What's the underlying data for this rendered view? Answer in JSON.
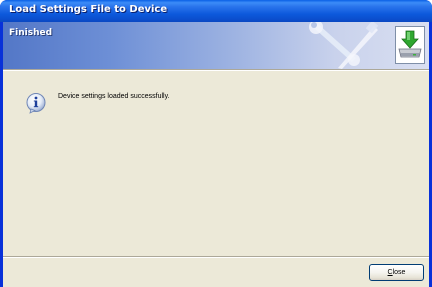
{
  "window": {
    "title": "Load Settings File to Device"
  },
  "header": {
    "title": "Finished",
    "graphic_icon": "tools-icon",
    "status_icon": "install-download-icon"
  },
  "message": {
    "icon": "info-icon",
    "text": "Device settings loaded successfully."
  },
  "footer": {
    "close_label_mnemonic": "C",
    "close_label_rest": "lose"
  },
  "colors": {
    "titlebar": "#0a58db",
    "client_bg": "#ece9d8",
    "header_start": "#5377c7",
    "header_end": "#d9dff1"
  }
}
